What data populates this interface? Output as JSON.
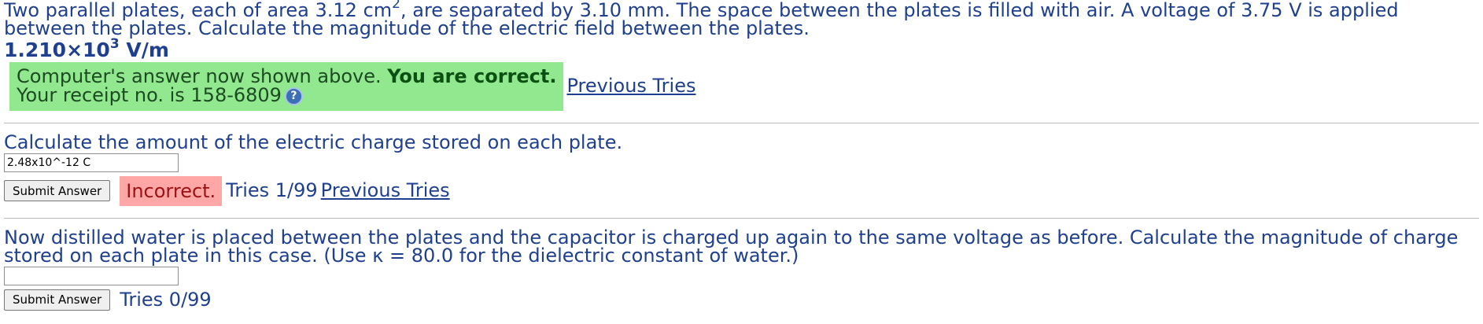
{
  "part1": {
    "question_before_sup": "Two parallel plates, each of area 3.12 cm",
    "question_sup": "2",
    "question_after_sup": ", are separated by 3.10 mm. The space between the plates is filled with air. A voltage of 3.75 V is applied between the plates. Calculate the magnitude of the electric field between the plates.",
    "answer_mantissa": "1.210×10",
    "answer_exponent": "3",
    "answer_unit": " V/m",
    "feedback_prefix": "Computer's answer now shown above. ",
    "feedback_bold": "You are correct.",
    "receipt_text": "Your receipt no. is 158-6809",
    "help_icon_glyph": "?",
    "previous_tries_link": "Previous Tries"
  },
  "part2": {
    "question": "Calculate the amount of the electric charge stored on each plate.",
    "input_value": "2.48x10^-12 C",
    "submit_label": "Submit Answer",
    "result_label": "Incorrect.",
    "tries": "Tries 1/99",
    "previous_tries_link": "Previous Tries"
  },
  "part3": {
    "question": "Now distilled water is placed between the plates and the capacitor is charged up again to the same voltage as before. Calculate the magnitude of charge stored on each plate in this case. (Use κ = 80.0 for the dielectric constant of water.)",
    "input_value": "",
    "submit_label": "Submit Answer",
    "tries": "Tries 0/99"
  },
  "colors": {
    "text": "#1f3f8f",
    "correct_bg": "#92e88e",
    "incorrect_bg": "#ffa7a7"
  }
}
